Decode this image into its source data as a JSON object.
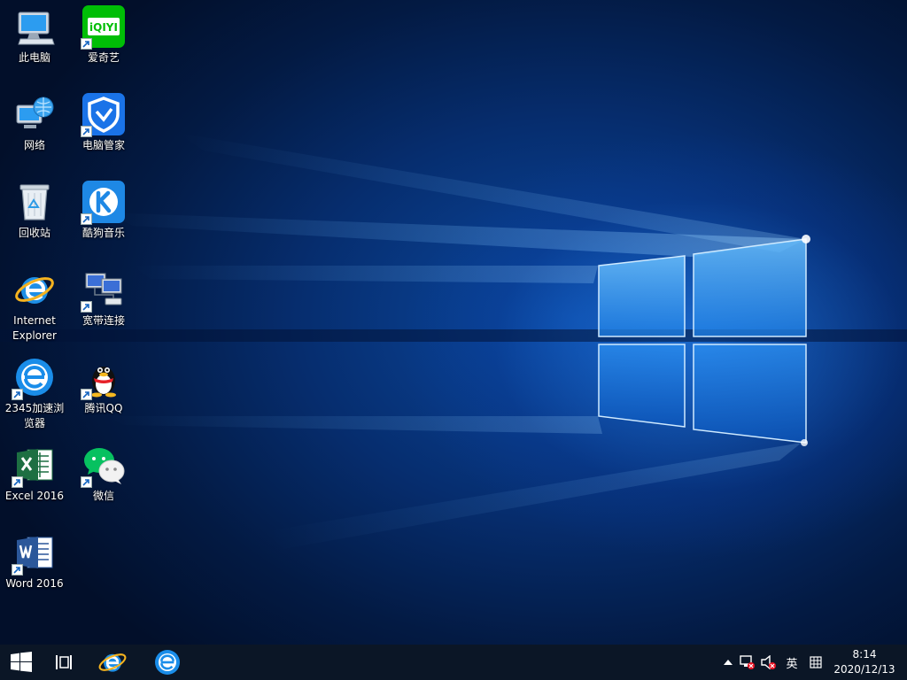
{
  "desktop_icons": [
    {
      "label": "此电脑"
    },
    {
      "label": "爱奇艺"
    },
    {
      "label": "网络"
    },
    {
      "label": "电脑管家"
    },
    {
      "label": "回收站"
    },
    {
      "label": "酷狗音乐"
    },
    {
      "label": "Internet Explorer"
    },
    {
      "label": "宽带连接"
    },
    {
      "label": "2345加速浏览器"
    },
    {
      "label": "腾讯QQ"
    },
    {
      "label": "Excel 2016"
    },
    {
      "label": "微信"
    },
    {
      "label": "Word 2016"
    }
  ],
  "iqiyi_logo_text": "iQIYI",
  "tray": {
    "ime_label": "英",
    "time": "8:14",
    "date": "2020/12/13"
  },
  "colors": {
    "taskbar": "#0b1626",
    "iqiyi_green": "#00be06",
    "pcmgr_blue": "#1a73e8",
    "kugou_blue": "#1e88e5",
    "excel_green": "#1d6f42",
    "word_blue": "#2b579a",
    "wechat_green": "#07c160"
  }
}
